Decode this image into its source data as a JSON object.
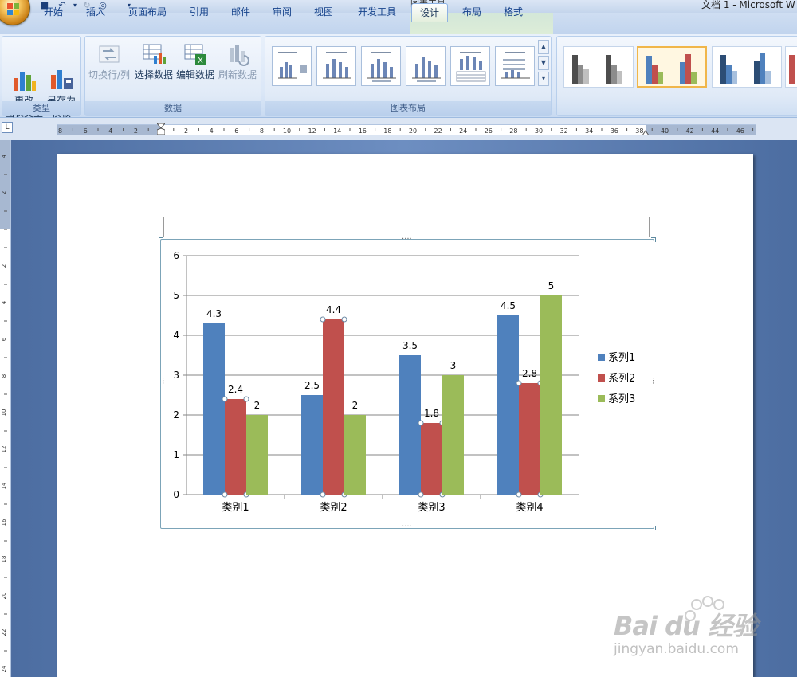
{
  "titlebar": {
    "tool_tab_label": "图表工具",
    "window_title": "文档 1 - Microsoft W"
  },
  "tabs": [
    {
      "label": "开始",
      "active": false
    },
    {
      "label": "插入",
      "active": false
    },
    {
      "label": "页面布局",
      "active": false
    },
    {
      "label": "引用",
      "active": false
    },
    {
      "label": "邮件",
      "active": false
    },
    {
      "label": "审阅",
      "active": false
    },
    {
      "label": "视图",
      "active": false
    },
    {
      "label": "开发工具",
      "active": false
    },
    {
      "label": "设计",
      "active": true
    },
    {
      "label": "布局",
      "active": false
    },
    {
      "label": "格式",
      "active": false
    }
  ],
  "ribbon": {
    "type_group": {
      "label": "类型",
      "change_type": "更改\n图表类型",
      "save_template": "另存为\n模板"
    },
    "data_group": {
      "label": "数据",
      "switch_row_col": "切换行/列",
      "select_data": "选择数据",
      "edit_data": "编辑数据",
      "refresh_data": "刷新数据"
    },
    "layout_group": {
      "label": "图表布局"
    }
  },
  "ruler": {
    "corner": "L"
  },
  "colors": {
    "series1": "#4f81bd",
    "series2": "#c0504d",
    "series3": "#9bbb59"
  },
  "chart_data": {
    "type": "bar",
    "categories": [
      "类别1",
      "类别2",
      "类别3",
      "类别4"
    ],
    "series": [
      {
        "name": "系列1",
        "values": [
          4.3,
          2.5,
          3.5,
          4.5
        ]
      },
      {
        "name": "系列2",
        "values": [
          2.4,
          4.4,
          1.8,
          2.8
        ]
      },
      {
        "name": "系列3",
        "values": [
          2,
          2,
          3,
          5
        ]
      }
    ],
    "ylim": [
      0,
      6
    ],
    "yticks": [
      0,
      1,
      2,
      3,
      4,
      5,
      6
    ],
    "grid": true,
    "legend": "right",
    "data_labels": true
  },
  "watermark": {
    "brand": "Bai du 经验",
    "url": "jingyan.baidu.com"
  }
}
